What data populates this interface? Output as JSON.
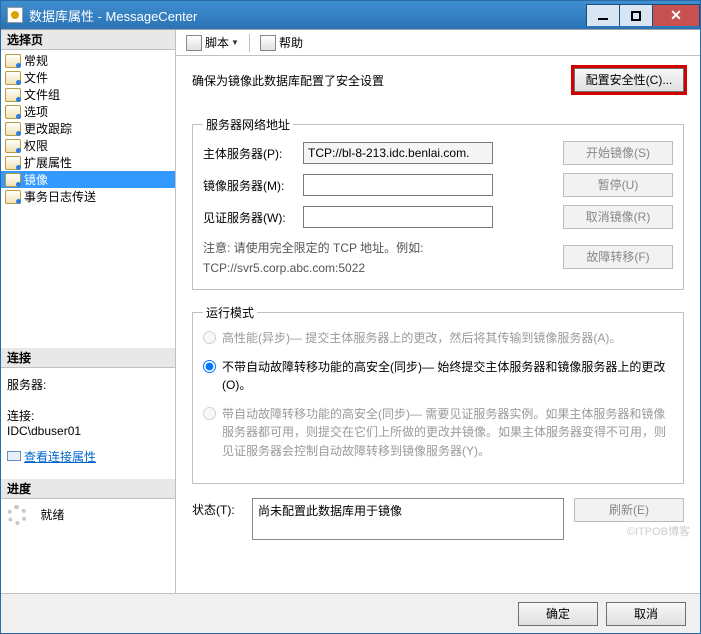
{
  "window": {
    "title": "数据库属性 - MessageCenter"
  },
  "sidebar": {
    "select_hdr": "选择页",
    "items": [
      {
        "label": "常规"
      },
      {
        "label": "文件"
      },
      {
        "label": "文件组"
      },
      {
        "label": "选项"
      },
      {
        "label": "更改跟踪"
      },
      {
        "label": "权限"
      },
      {
        "label": "扩展属性"
      },
      {
        "label": "镜像"
      },
      {
        "label": "事务日志传送"
      }
    ],
    "conn_hdr": "连接",
    "server_label": "服务器:",
    "server_value": "",
    "conn_label": "连接:",
    "conn_value": "IDC\\dbuser01",
    "view_conn_link": "查看连接属性",
    "progress_hdr": "进度",
    "ready": "就绪"
  },
  "toolbar": {
    "script": "脚本",
    "help": "帮助"
  },
  "main": {
    "ensure_text": "确保为镜像此数据库配置了安全设置",
    "config_btn": "配置安全性(C)...",
    "netaddr_legend": "服务器网络地址",
    "principal_label": "主体服务器(P):",
    "principal_value": "TCP://bl-8-213.idc.benlai.com.",
    "mirror_label": "镜像服务器(M):",
    "witness_label": "见证服务器(W):",
    "start_btn": "开始镜像(S)",
    "pause_btn": "暂停(U)",
    "remove_btn": "取消镜像(R)",
    "failover_btn": "故障转移(F)",
    "note_line1": "注意: 请使用完全限定的 TCP 地址。例如:",
    "note_line2": "TCP://svr5.corp.abc.com:5022",
    "mode_legend": "运行模式",
    "mode_a": "高性能(异步)— 提交主体服务器上的更改，然后将其传输到镜像服务器(A)。",
    "mode_b": "不带自动故障转移功能的高安全(同步)— 始终提交主体服务器和镜像服务器上的更改(O)。",
    "mode_c": "带自动故障转移功能的高安全(同步)— 需要见证服务器实例。如果主体服务器和镜像服务器都可用，则提交在它们上所做的更改并镜像。如果主体服务器变得不可用，则见证服务器会控制自动故障转移到镜像服务器(Y)。",
    "status_label": "状态(T):",
    "status_value": "尚未配置此数据库用于镜像",
    "refresh_btn": "刷新(E)"
  },
  "bottom": {
    "ok": "确定",
    "cancel": "取消"
  },
  "watermark": "©ITPOB博客"
}
